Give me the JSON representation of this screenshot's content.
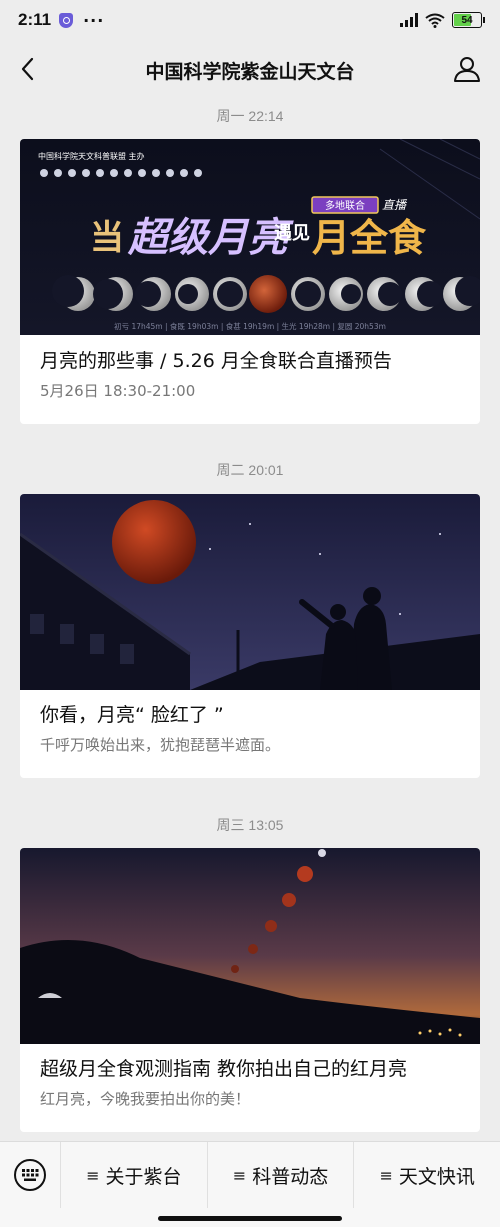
{
  "status": {
    "time": "2:11",
    "dots": "···",
    "battery": "54"
  },
  "nav": {
    "title": "中国科学院紫金山天文台"
  },
  "articles": [
    {
      "timestamp": "周一 22:14",
      "title": "月亮的那些事 / 5.26 月全食联合直播预告",
      "subtitle": "5月26日 18:30-21:00",
      "cover": {
        "organizer": "中国科学院天文科普联盟 主办",
        "headline_a": "当",
        "headline_b": "超级月亮",
        "headline_c": "遇见",
        "headline_d": "月全食",
        "tag": "多地联合",
        "tag2": "直播",
        "phases": "初亏 17h45m | 食既 19h03m | 食甚 19h19m | 生光 19h28m | 复圆 20h53m"
      }
    },
    {
      "timestamp": "周二 20:01",
      "title": "你看，月亮“ 脸红了 ”",
      "subtitle": "千呼万唤始出来，犹抱琵琶半遮面。"
    },
    {
      "timestamp": "周三 13:05",
      "title": "超级月全食观测指南 教你拍出自己的红月亮",
      "subtitle": "红月亮，今晚我要拍出你的美！"
    }
  ],
  "menu": {
    "items": [
      {
        "label": "关于紫台"
      },
      {
        "label": "科普动态"
      },
      {
        "label": "天文快讯"
      }
    ],
    "bars_glyph": "≡"
  },
  "colors": {
    "background": "#ededed",
    "card": "#ffffff",
    "accent_moon": "#b33a1e"
  }
}
